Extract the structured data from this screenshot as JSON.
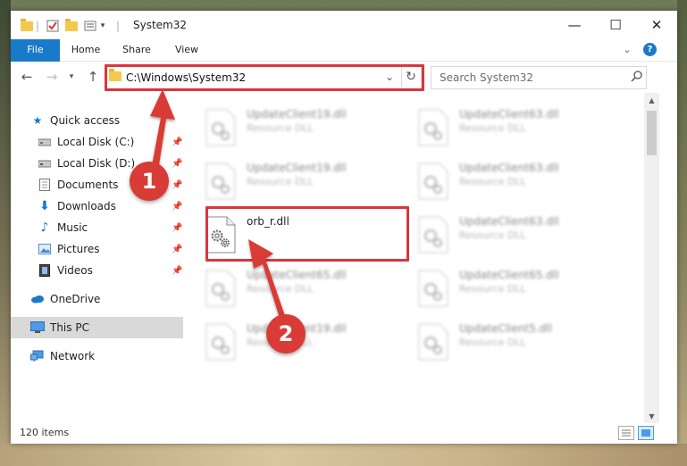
{
  "window": {
    "title": "System32",
    "controls": {
      "minimize": "—",
      "maximize": "☐",
      "close": "✕"
    }
  },
  "ribbon": {
    "tabs": [
      "File",
      "Home",
      "Share",
      "View"
    ],
    "expand": "⌄",
    "help": "?"
  },
  "address": {
    "path": "C:\\Windows\\System32",
    "search_placeholder": "Search System32"
  },
  "nav": {
    "quick_access": "Quick access",
    "items": [
      {
        "label": "Local Disk (C:)",
        "icon": "drive-icon",
        "pinned": true
      },
      {
        "label": "Local Disk (D:)",
        "icon": "drive-icon",
        "pinned": true
      },
      {
        "label": "Documents",
        "icon": "documents-icon",
        "pinned": true
      },
      {
        "label": "Downloads",
        "icon": "downloads-icon",
        "pinned": true
      },
      {
        "label": "Music",
        "icon": "music-icon",
        "pinned": true
      },
      {
        "label": "Pictures",
        "icon": "pictures-icon",
        "pinned": true
      },
      {
        "label": "Videos",
        "icon": "videos-icon",
        "pinned": true
      }
    ],
    "onedrive": "OneDrive",
    "this_pc": "This PC",
    "network": "Network"
  },
  "files": {
    "items": [
      {
        "name": "UpdateClient19.dll",
        "desc": "Resource DLL",
        "blurred": true
      },
      {
        "name": "UpdateClient63.dll",
        "desc": "Resource DLL",
        "blurred": true
      },
      {
        "name": "UpdateClient19.dll",
        "desc": "Resource DLL",
        "blurred": true
      },
      {
        "name": "UpdateClient63.dll",
        "desc": "Resource DLL",
        "blurred": true
      },
      {
        "name": "orb_r.dll",
        "desc": "",
        "blurred": false
      },
      {
        "name": "UpdateClient63.dll",
        "desc": "Resource DLL",
        "blurred": true
      },
      {
        "name": "UpdateClient65.dll",
        "desc": "Resource DLL",
        "blurred": true
      },
      {
        "name": "UpdateClient65.dll",
        "desc": "Resource DLL",
        "blurred": true
      },
      {
        "name": "UpdateClient19.dll",
        "desc": "Resource DLL",
        "blurred": true
      },
      {
        "name": "UpdateClient5.dll",
        "desc": "Resource DLL",
        "blurred": true
      }
    ]
  },
  "status": {
    "count": "120 items"
  },
  "annotations": {
    "badge1": "1",
    "badge2": "2",
    "color": "#d93b36"
  }
}
